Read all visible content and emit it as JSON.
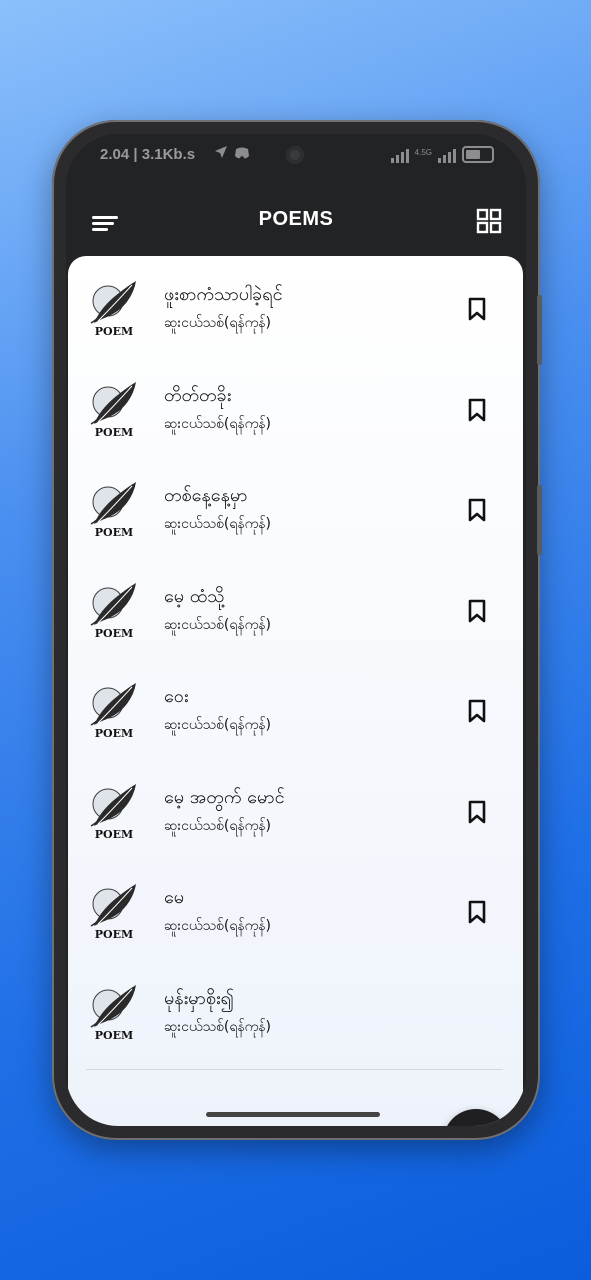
{
  "status_bar": {
    "time": "2.04 | 3.1Kb.s",
    "network": "4.5G"
  },
  "header": {
    "title": "POEMS",
    "menu_icon": "menu-icon",
    "grid_icon": "grid-view-icon"
  },
  "thumbnail_label": "POEM",
  "poems": [
    {
      "title": "ဖူးစာကံသာပါခဲ့ရင်",
      "author": "ဆူးငယ်သစ်(ရန်ကုန်)"
    },
    {
      "title": "တိတ်တခိုး",
      "author": "ဆူးငယ်သစ်(ရန်ကုန်)"
    },
    {
      "title": "တစ်နေ့နေ့မှာ",
      "author": "ဆူးငယ်သစ်(ရန်ကုန်)"
    },
    {
      "title": "မေ့ ထံသို့",
      "author": "ဆူးငယ်သစ်(ရန်ကုန်)"
    },
    {
      "title": "ဝေး",
      "author": "ဆူးငယ်သစ်(ရန်ကုန်)"
    },
    {
      "title": "မေ့ အတွက် မောင်",
      "author": "ဆူးငယ်သစ်(ရန်ကုန်)"
    },
    {
      "title": "မေ",
      "author": "ဆူးငယ်သစ်(ရန်ကုန်)"
    },
    {
      "title": "မုန်းမှာစိုး၍",
      "author": "ဆူးငယ်သစ်(ရန်ကုန်)"
    }
  ],
  "fab": {
    "icon": "search-icon"
  },
  "colors": {
    "background": "#1f6fe6",
    "appbar": "#222325",
    "fab": "#1f1f21"
  }
}
